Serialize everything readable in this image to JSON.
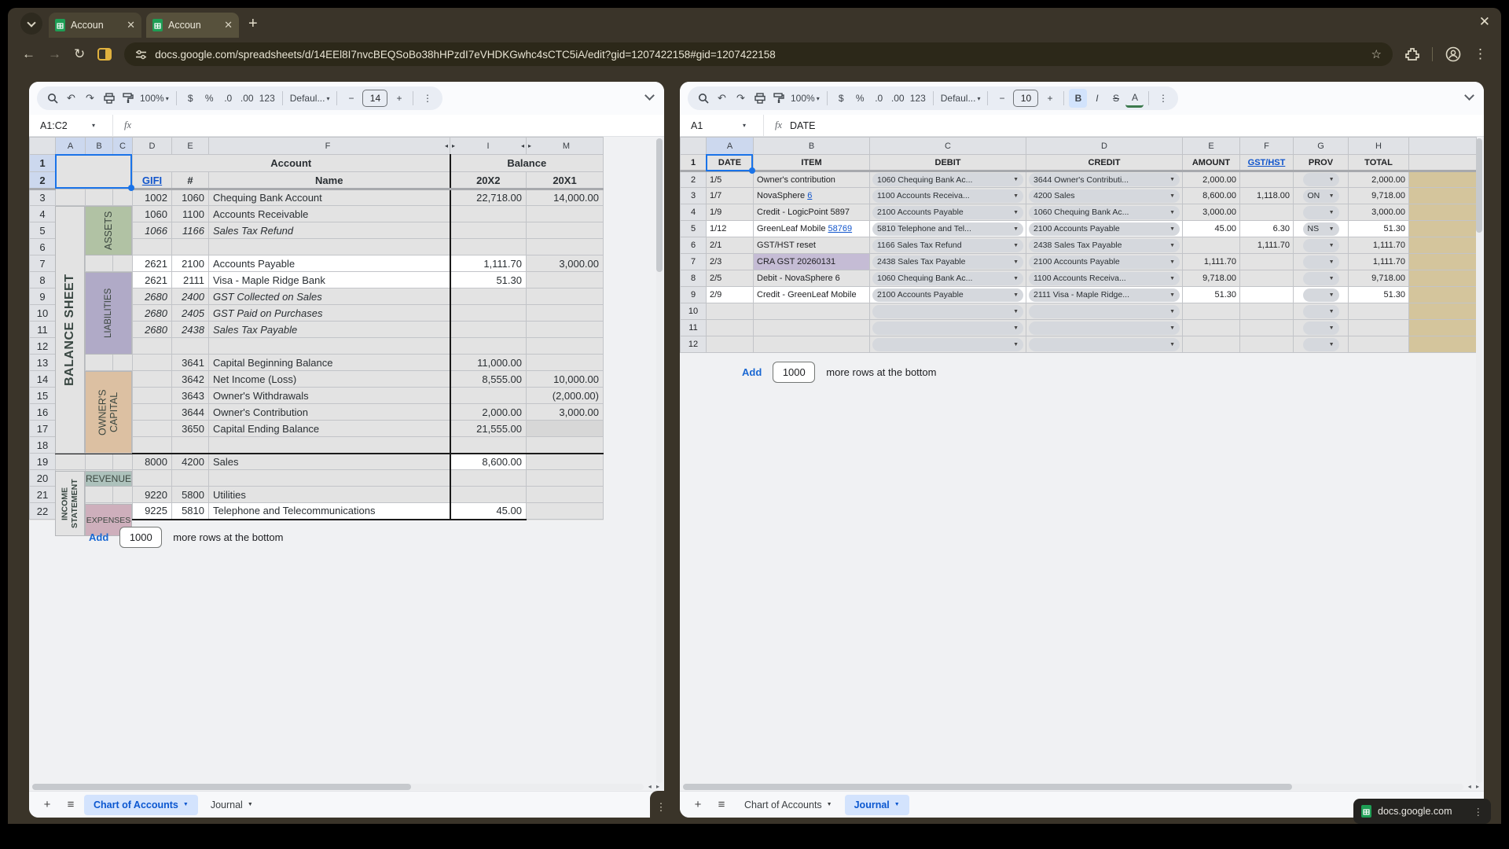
{
  "chrome": {
    "tabs": [
      {
        "title": "Accoun"
      },
      {
        "title": "Accoun"
      }
    ],
    "tab_close": "✕",
    "new_tab": "+",
    "window_close": "✕",
    "url": "docs.google.com/spreadsheets/d/14EEl8I7nvcBEQSoBo38hHPzdI7eVHDKGwhc4sCTC5iA/edit?gid=1207422158#gid=1207422158",
    "origin_chip": "docs.google.com",
    "back": "←",
    "forward": "→",
    "reload": "↻",
    "star": "☆",
    "kebab": "⋮"
  },
  "toolbar": {
    "zoom": "100%",
    "currency": "$",
    "percent": "%",
    "dec_less": ".0",
    "dec_more": ".00",
    "fmt_123": "123",
    "font": "Defaul...",
    "minus": "−",
    "plus": "+",
    "bold": "B",
    "italic": "I",
    "strike": "S",
    "color": "A",
    "more": "⋮"
  },
  "left": {
    "font_size": "14",
    "name_box": "A1:C2",
    "formula": "",
    "cols": [
      "A",
      "B",
      "C",
      "D",
      "E",
      "F",
      "I",
      "M"
    ],
    "marker_l": "◂",
    "marker_r": "▸",
    "h1": {
      "account": "Account",
      "balance": "Balance"
    },
    "h2": {
      "gifi": "GIFI",
      "hash": "#",
      "name": "Name",
      "y2": "20X2",
      "y1": "20X1"
    },
    "labels": {
      "bs": "BALANCE SHEET",
      "is": "INCOME\nSTATEMENT",
      "assets": "ASSETS",
      "liab": "LIABILITIES",
      "oc": "OWNER'S\nCAPITAL",
      "rev": "REVENUE",
      "exp": "EXPENSES"
    },
    "rows": [
      {
        "n": "3",
        "g": "1002",
        "a": "1060",
        "nm": "Chequing Bank Account",
        "y2": "22,718.00",
        "y1": "14,000.00"
      },
      {
        "n": "4",
        "g": "1060",
        "a": "1100",
        "nm": "Accounts Receivable",
        "y2": "",
        "y1": ""
      },
      {
        "n": "5",
        "g": "1066",
        "a": "1166",
        "nm": "Sales Tax Refund",
        "y2": "",
        "y1": "",
        "it": 1
      },
      {
        "n": "6",
        "g": "",
        "a": "",
        "nm": "",
        "y2": "",
        "y1": ""
      },
      {
        "n": "7",
        "g": "2621",
        "a": "2100",
        "nm": "Accounts Payable",
        "y2": "1,111.70",
        "y1": "3,000.00",
        "wh": 1
      },
      {
        "n": "8",
        "g": "2621",
        "a": "2111",
        "nm": "Visa - Maple Ridge Bank",
        "y2": "51.30",
        "y1": "",
        "wh": 1
      },
      {
        "n": "9",
        "g": "2680",
        "a": "2400",
        "nm": "GST Collected on Sales",
        "y2": "",
        "y1": "",
        "it": 1
      },
      {
        "n": "10",
        "g": "2680",
        "a": "2405",
        "nm": "GST Paid on Purchases",
        "y2": "",
        "y1": "",
        "it": 1
      },
      {
        "n": "11",
        "g": "2680",
        "a": "2438",
        "nm": "Sales Tax Payable",
        "y2": "",
        "y1": "",
        "it": 1
      },
      {
        "n": "12",
        "g": "",
        "a": "",
        "nm": "",
        "y2": "",
        "y1": ""
      },
      {
        "n": "13",
        "g": "",
        "a": "3641",
        "nm": "Capital Beginning Balance",
        "y2": "11,000.00",
        "y1": ""
      },
      {
        "n": "14",
        "g": "",
        "a": "3642",
        "nm": "Net Income (Loss)",
        "y2": "8,555.00",
        "y1": "10,000.00"
      },
      {
        "n": "15",
        "g": "",
        "a": "3643",
        "nm": "Owner's Withdrawals",
        "y2": "",
        "y1": "(2,000.00)"
      },
      {
        "n": "16",
        "g": "",
        "a": "3644",
        "nm": "Owner's Contribution",
        "y2": "2,000.00",
        "y1": "3,000.00"
      },
      {
        "n": "17",
        "g": "",
        "a": "3650",
        "nm": "Capital Ending Balance",
        "y2": "21,555.00",
        "y1": "",
        "md": 1
      },
      {
        "n": "18",
        "g": "",
        "a": "",
        "nm": "",
        "y2": "",
        "y1": ""
      },
      {
        "n": "19",
        "g": "8000",
        "a": "4200",
        "nm": "Sales",
        "y2": "8,600.00",
        "y1": "",
        "top": 1,
        "iw": 1
      },
      {
        "n": "20",
        "g": "",
        "a": "",
        "nm": "",
        "y2": "",
        "y1": ""
      },
      {
        "n": "21",
        "g": "9220",
        "a": "5800",
        "nm": "Utilities",
        "y2": "",
        "y1": ""
      },
      {
        "n": "22",
        "g": "9225",
        "a": "5810",
        "nm": "Telephone and Telecommunications",
        "y2": "45.00",
        "y1": "",
        "wh": 1,
        "bot": 1
      }
    ],
    "add": {
      "btn": "Add",
      "count": "1000",
      "txt": "more rows at the bottom"
    },
    "sheet_tabs": [
      {
        "label": "Chart of Accounts",
        "active": true
      },
      {
        "label": "Journal",
        "active": false
      }
    ]
  },
  "right": {
    "font_size": "10",
    "name_box": "A1",
    "formula": "DATE",
    "cols": [
      "A",
      "B",
      "C",
      "D",
      "E",
      "F",
      "G",
      "H"
    ],
    "h1": [
      "DATE",
      "ITEM",
      "DEBIT",
      "CREDIT",
      "AMOUNT",
      "GST/HST",
      "PROV",
      "TOTAL"
    ],
    "rows": [
      {
        "n": "2",
        "d": "1/5",
        "item": "Owner's contribution",
        "lk": "",
        "de": "1060 Chequing Bank Ac...",
        "cr": "3644 Owner's Contributi...",
        "am": "2,000.00",
        "gs": "",
        "pv": "",
        "tt": "2,000.00"
      },
      {
        "n": "3",
        "d": "1/7",
        "item": "NovaSphere ",
        "lk": "6",
        "de": "1100 Accounts Receiva...",
        "cr": "4200 Sales",
        "am": "8,600.00",
        "gs": "1,118.00",
        "pv": "ON",
        "tt": "9,718.00"
      },
      {
        "n": "4",
        "d": "1/9",
        "item": "Credit - LogicPoint 5897",
        "lk": "",
        "de": "2100 Accounts Payable",
        "cr": "1060 Chequing Bank Ac...",
        "am": "3,000.00",
        "gs": "",
        "pv": "",
        "tt": "3,000.00"
      },
      {
        "n": "5",
        "d": "1/12",
        "item": "GreenLeaf Mobile ",
        "lk": "58769",
        "de": "5810 Telephone and Tel...",
        "cr": "2100 Accounts Payable",
        "am": "45.00",
        "gs": "6.30",
        "pv": "NS",
        "tt": "51.30",
        "wh": 1
      },
      {
        "n": "6",
        "d": "2/1",
        "item": "GST/HST reset",
        "lk": "",
        "de": "1166 Sales Tax Refund",
        "cr": "2438 Sales Tax Payable",
        "am": "",
        "gs": "1,111.70",
        "pv": "",
        "tt": "1,111.70"
      },
      {
        "n": "7",
        "d": "2/3",
        "item": "CRA GST 20260131",
        "lk": "",
        "de": "2438 Sales Tax Payable",
        "cr": "2100 Accounts Payable",
        "am": "1,111.70",
        "gs": "",
        "pv": "",
        "tt": "1,111.70",
        "pu": 1
      },
      {
        "n": "8",
        "d": "2/5",
        "item": "Debit - NovaSphere 6",
        "lk": "",
        "de": "1060 Chequing Bank Ac...",
        "cr": "1100 Accounts Receiva...",
        "am": "9,718.00",
        "gs": "",
        "pv": "",
        "tt": "9,718.00"
      },
      {
        "n": "9",
        "d": "2/9",
        "item": "Credit - GreenLeaf Mobile",
        "lk": "",
        "de": "2100 Accounts Payable",
        "cr": "2111 Visa - Maple Ridge...",
        "am": "51.30",
        "gs": "",
        "pv": "",
        "tt": "51.30",
        "wh": 1
      },
      {
        "n": "10",
        "d": "",
        "item": "",
        "lk": "",
        "de": "",
        "cr": "",
        "am": "",
        "gs": "",
        "pv": "",
        "tt": "",
        "emp": 1
      },
      {
        "n": "11",
        "d": "",
        "item": "",
        "lk": "",
        "de": "",
        "cr": "",
        "am": "",
        "gs": "",
        "pv": "",
        "tt": "",
        "emp": 1
      },
      {
        "n": "12",
        "d": "",
        "item": "",
        "lk": "",
        "de": "",
        "cr": "",
        "am": "",
        "gs": "",
        "pv": "",
        "tt": "",
        "emp": 1
      }
    ],
    "add": {
      "btn": "Add",
      "count": "1000",
      "txt": "more rows at the bottom"
    },
    "sheet_tabs": [
      {
        "label": "Chart of Accounts",
        "active": false
      },
      {
        "label": "Journal",
        "active": true
      }
    ]
  }
}
